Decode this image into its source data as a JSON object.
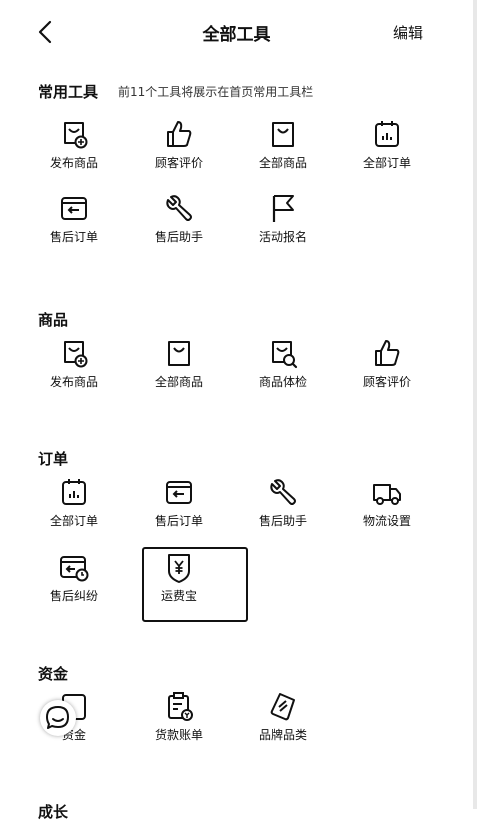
{
  "header": {
    "title": "全部工具",
    "edit_label": "编辑"
  },
  "sections": {
    "common": {
      "title": "常用工具",
      "subtitle": "前11个工具将展示在首页常用工具栏",
      "items": [
        "发布商品",
        "顾客评价",
        "全部商品",
        "全部订单",
        "售后订单",
        "售后助手",
        "活动报名"
      ]
    },
    "goods": {
      "title": "商品",
      "items": [
        "发布商品",
        "全部商品",
        "商品体检",
        "顾客评价"
      ]
    },
    "orders": {
      "title": "订单",
      "items": [
        "全部订单",
        "售后订单",
        "售后助手",
        "物流设置",
        "售后纠纷",
        "运费宝"
      ]
    },
    "funds": {
      "title": "资金",
      "items": [
        "资金",
        "货款账单",
        "品牌品类"
      ]
    },
    "growth": {
      "title": "成长"
    }
  },
  "icons": {
    "back": "chevron-left-icon",
    "publish": "bag-plus-icon",
    "review": "thumbs-up-icon",
    "goods": "bag-icon",
    "orders": "clipboard-chart-icon",
    "aftersale": "card-return-icon",
    "assistant": "wrench-icon",
    "activity": "flag-icon",
    "inspect": "bag-search-icon",
    "logistics": "truck-icon",
    "dispute": "card-clock-icon",
    "freight": "shield-yen-icon",
    "bill": "clipboard-money-icon",
    "brand": "tag-icon",
    "chat": "chat-icon"
  }
}
